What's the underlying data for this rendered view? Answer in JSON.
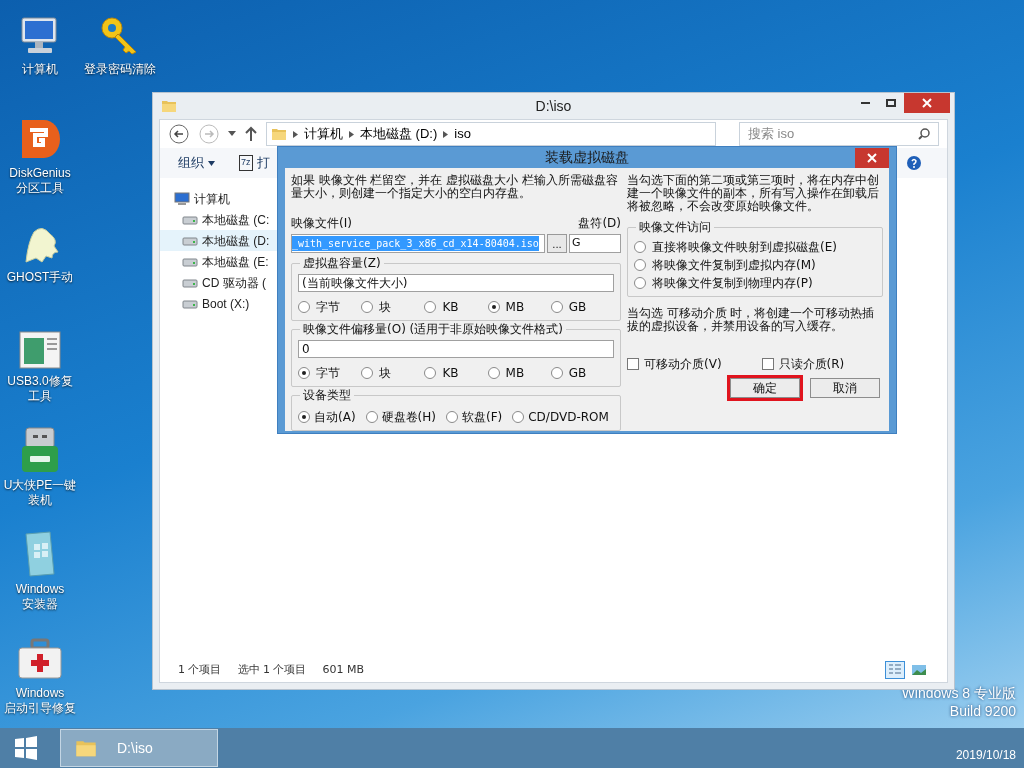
{
  "desktop": {
    "icons": [
      {
        "lines": [
          "计算机"
        ]
      },
      {
        "lines": [
          "登录密码清除"
        ]
      },
      {
        "lines": [
          "DiskGenius",
          "分区工具"
        ]
      },
      {
        "lines": [
          "GHOST手动"
        ]
      },
      {
        "lines": [
          "USB3.0修复",
          "工具"
        ]
      },
      {
        "lines": [
          "U大侠PE一键",
          "装机"
        ]
      },
      {
        "lines": [
          "Windows",
          "安装器"
        ]
      },
      {
        "lines": [
          "Windows",
          "启动引导修复"
        ]
      }
    ],
    "edition": [
      "Windows 8 专业版",
      "Build 9200"
    ]
  },
  "explorer": {
    "title": "D:\\iso",
    "breadcrumb": [
      "计算机",
      "本地磁盘 (D:)",
      "iso"
    ],
    "search": {
      "placeholder": "搜索 iso"
    },
    "toolbar": [
      {
        "label": "组织"
      },
      {
        "label": "打",
        "badge": "7z"
      }
    ],
    "nav_tree": [
      {
        "label": "计算机",
        "children": [
          {
            "label": "本地磁盘 (C:",
            "selected": false
          },
          {
            "label": "本地磁盘 (D:",
            "selected": true
          },
          {
            "label": "本地磁盘 (E:",
            "selected": false
          },
          {
            "label": "CD 驱动器 (",
            "selected": false
          },
          {
            "label": "Boot (X:)",
            "selected": false
          }
        ]
      }
    ],
    "status": [
      "1 个项目",
      "选中 1 个项目",
      "601 MB"
    ],
    "views": [
      {
        "selected": true
      },
      {
        "selected": false
      }
    ]
  },
  "dialog": {
    "title": "装载虚拟磁盘",
    "intro": "如果 映像文件 栏留空，并在 虚拟磁盘大小 栏输入所需磁盘容量大小，则创建一个指定大小的空白内存盘。",
    "image_file": {
      "label": "映像文件(I)",
      "value": "_with_service_pack_3_x86_cd_x14-80404.iso",
      "selected": true,
      "browse": "..."
    },
    "drive": {
      "label": "盘符(D)",
      "value": "G"
    },
    "size_group": {
      "legend": "虚拟盘容量(Z)",
      "value": "(当前映像文件大小)",
      "units": [
        {
          "label": "字节",
          "selected": false
        },
        {
          "label": "块",
          "selected": false
        },
        {
          "label": "KB",
          "selected": false
        },
        {
          "label": "MB",
          "selected": true
        },
        {
          "label": "GB",
          "selected": false
        }
      ]
    },
    "offset_group": {
      "legend": "映像文件偏移量(O) (适用于非原始映像文件格式)",
      "value": "0",
      "units": [
        {
          "label": "字节",
          "selected": true
        },
        {
          "label": "块",
          "selected": false
        },
        {
          "label": "KB",
          "selected": false
        },
        {
          "label": "MB",
          "selected": false
        },
        {
          "label": "GB",
          "selected": false
        }
      ]
    },
    "device_group": {
      "legend": "设备类型",
      "options": [
        {
          "label": "自动(A)",
          "selected": true
        },
        {
          "label": "硬盘卷(H)",
          "selected": false
        },
        {
          "label": "软盘(F)",
          "selected": false
        },
        {
          "label": "CD/DVD-ROM",
          "selected": false
        }
      ]
    },
    "access_note": "当勾选下面的第二项或第三项时，将在内存中创建一个映像文件的副本，所有写入操作在卸载后将被忽略，不会改变原始映像文件。",
    "access_group": {
      "legend": "映像文件访问",
      "options": [
        {
          "label": "直接将映像文件映射到虚拟磁盘(E)",
          "selected": false
        },
        {
          "label": "将映像文件复制到虚拟内存(M)",
          "selected": false
        },
        {
          "label": "将映像文件复制到物理内存(P)",
          "selected": false
        }
      ]
    },
    "removable_note": "当勾选 可移动介质 时，将创建一个可移动热插拔的虚拟设备，并禁用设备的写入缓存。",
    "checks": [
      {
        "label": "可移动介质(V)",
        "checked": false
      },
      {
        "label": "只读介质(R)",
        "checked": false
      }
    ],
    "buttons": [
      {
        "label": "确定",
        "highlighted": true
      },
      {
        "label": "取消",
        "highlighted": false
      }
    ]
  },
  "taskbar": {
    "tasks": [
      {
        "label": "D:\\iso",
        "selected": true
      }
    ],
    "date": "2019/10/18"
  }
}
